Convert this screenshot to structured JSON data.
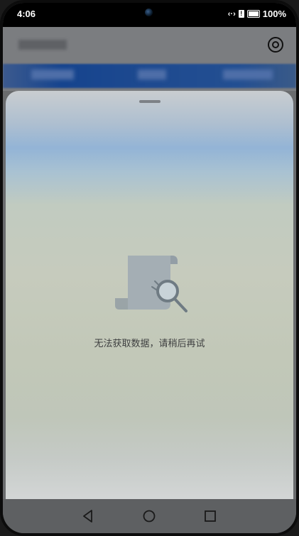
{
  "status_bar": {
    "time": "4:06",
    "battery_percent": "100%",
    "icons": [
      "data-sync-icon",
      "alert-icon",
      "battery-charging-icon"
    ]
  },
  "background_app": {
    "settings_icon": "settings-icon"
  },
  "sheet": {
    "empty_message": "无法获取数据，请稍后再试",
    "illustration_icon": "empty-document-search-icon"
  },
  "nav_bar": {
    "buttons": [
      "back-icon",
      "home-icon",
      "recents-icon"
    ]
  },
  "colors": {
    "sheet_sky": "#93b4d6",
    "sheet_body": "#c6cbbd",
    "nav_bar": "#5e6062",
    "banner_blue": "#16448e"
  }
}
